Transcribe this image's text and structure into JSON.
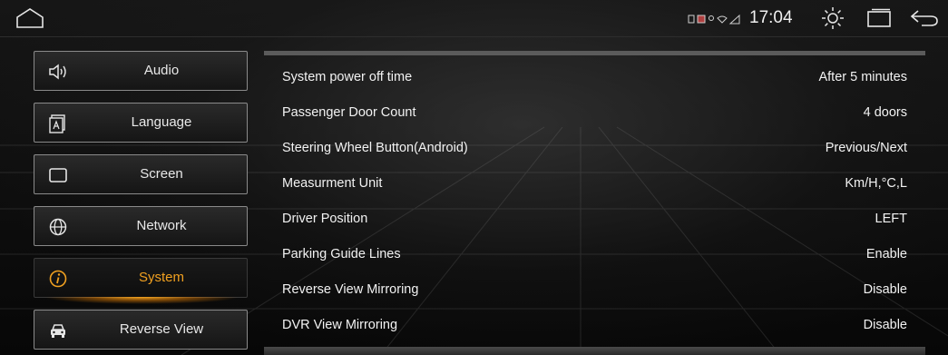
{
  "status_bar": {
    "time": "17:04",
    "icons": [
      "home-icon",
      "sd-card-icon",
      "sim-icon",
      "location-icon",
      "wifi-icon",
      "signal-icon",
      "brightness-icon",
      "recents-icon",
      "back-icon"
    ]
  },
  "sidebar": {
    "items": [
      {
        "label": "Audio",
        "icon": "speaker-icon"
      },
      {
        "label": "Language",
        "icon": "language-icon"
      },
      {
        "label": "Screen",
        "icon": "screen-icon"
      },
      {
        "label": "Network",
        "icon": "globe-icon"
      },
      {
        "label": "System",
        "icon": "info-icon",
        "active": true
      },
      {
        "label": "Reverse View",
        "icon": "car-icon"
      }
    ],
    "active_color": "#f0a020"
  },
  "settings": {
    "rows": [
      {
        "label": "System power off time",
        "value": "After 5 minutes"
      },
      {
        "label": "Passenger Door Count",
        "value": "4 doors"
      },
      {
        "label": "Steering Wheel Button(Android)",
        "value": "Previous/Next"
      },
      {
        "label": "Measurment Unit",
        "value": "Km/H,°C,L"
      },
      {
        "label": "Driver Position",
        "value": "LEFT"
      },
      {
        "label": "Parking Guide Lines",
        "value": "Enable"
      },
      {
        "label": "Reverse View Mirroring",
        "value": "Disable"
      },
      {
        "label": "DVR View Mirroring",
        "value": "Disable"
      }
    ]
  }
}
